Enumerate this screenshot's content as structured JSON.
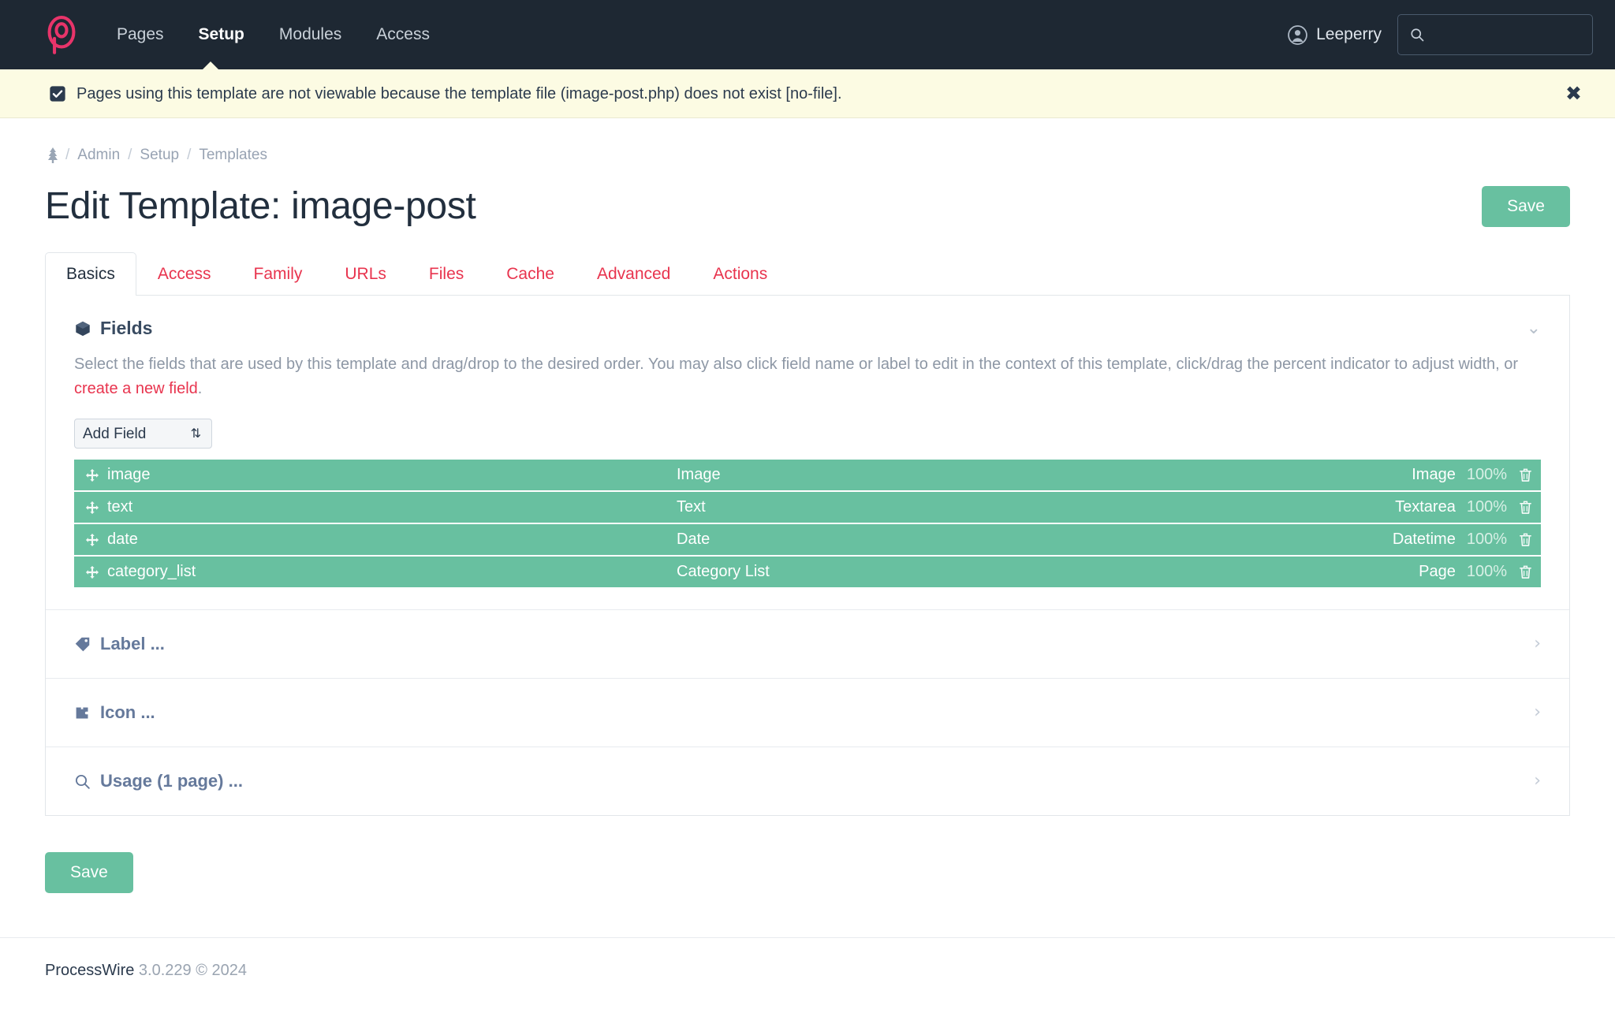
{
  "masthead": {
    "logo_alt": "processwire-logo",
    "nav": [
      {
        "label": "Pages",
        "active": false
      },
      {
        "label": "Setup",
        "active": true
      },
      {
        "label": "Modules",
        "active": false
      },
      {
        "label": "Access",
        "active": false
      }
    ],
    "user": "Leeperry",
    "search_placeholder": "",
    "search_value": ""
  },
  "notice": {
    "text": "Pages using this template are not viewable because the template file (image-post.php) does not exist [no-file].",
    "close_label": "✖",
    "bg_color": "#fcfbe3"
  },
  "breadcrumb": {
    "home_icon": "tree-icon",
    "items": [
      "Admin",
      "Setup",
      "Templates"
    ],
    "separator": "/"
  },
  "header": {
    "title": "Edit Template: image-post",
    "save_label": "Save"
  },
  "tabs": [
    {
      "label": "Basics",
      "active": true
    },
    {
      "label": "Access",
      "active": false
    },
    {
      "label": "Family",
      "active": false
    },
    {
      "label": "URLs",
      "active": false
    },
    {
      "label": "Files",
      "active": false
    },
    {
      "label": "Cache",
      "active": false
    },
    {
      "label": "Advanced",
      "active": false
    },
    {
      "label": "Actions",
      "active": false
    }
  ],
  "fields_section": {
    "title": "Fields",
    "icon": "cube-icon",
    "collapse_glyph": "⌄",
    "description_part1": "Select the fields that are used by this template and drag/drop to the desired order. You may also click field name or label to edit in the context of this template, click/drag the percent indicator to adjust width, or ",
    "description_link": "create a new field",
    "description_end": ".",
    "add_field_label": "Add Field",
    "row_color": "#68c0a0",
    "rows": [
      {
        "name": "image",
        "label": "Image",
        "type": "Image",
        "width": "100%"
      },
      {
        "name": "text",
        "label": "Text",
        "type": "Textarea",
        "width": "100%"
      },
      {
        "name": "date",
        "label": "Date",
        "type": "Datetime",
        "width": "100%"
      },
      {
        "name": "category_list",
        "label": "Category List",
        "type": "Page",
        "width": "100%"
      }
    ]
  },
  "collapsed_sections": [
    {
      "label": "Label ...",
      "icon": "tag-icon",
      "chevron": "›"
    },
    {
      "label": "Icon ...",
      "icon": "puzzle-icon",
      "chevron": "›"
    },
    {
      "label": "Usage (1 page) ...",
      "icon": "search-icon",
      "chevron": "›"
    }
  ],
  "bottom": {
    "save_label": "Save"
  },
  "footer": {
    "brand": "ProcessWire",
    "version": "3.0.229 © 2024"
  }
}
